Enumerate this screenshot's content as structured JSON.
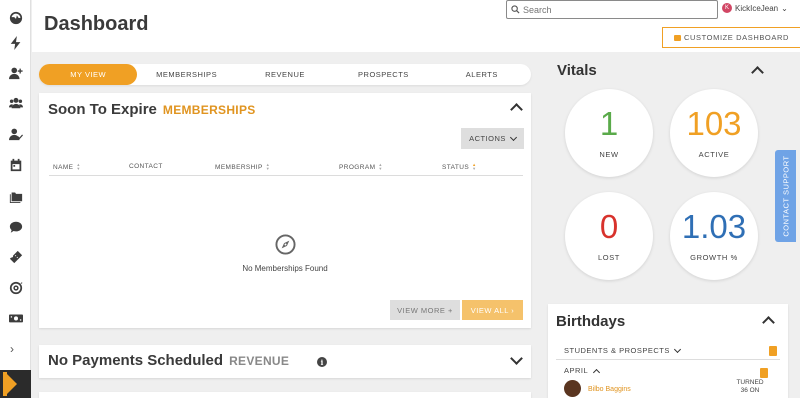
{
  "header": {
    "title": "Dashboard",
    "search_placeholder": "Search",
    "user_initial": "K",
    "user_name": "KickIceJean",
    "customize_label": "CUSTOMIZE DASHBOARD"
  },
  "sidebar": {
    "items": [
      {
        "icon": "gauge-icon"
      },
      {
        "icon": "bolt-icon"
      },
      {
        "icon": "add-user-icon"
      },
      {
        "icon": "users-icon"
      },
      {
        "icon": "user-check-icon"
      },
      {
        "icon": "calendar-icon"
      },
      {
        "icon": "folders-icon"
      },
      {
        "icon": "chat-icon"
      },
      {
        "icon": "ticket-icon"
      },
      {
        "icon": "target-icon"
      },
      {
        "icon": "money-icon"
      }
    ],
    "expand_glyph": "›"
  },
  "tabs": [
    {
      "label": "MY VIEW",
      "active": true
    },
    {
      "label": "MEMBERSHIPS",
      "active": false
    },
    {
      "label": "REVENUE",
      "active": false
    },
    {
      "label": "PROSPECTS",
      "active": false
    },
    {
      "label": "ALERTS",
      "active": false
    }
  ],
  "expire_panel": {
    "title": "Soon To Expire",
    "subtitle": "MEMBERSHIPS",
    "actions_label": "ACTIONS",
    "columns": [
      "NAME",
      "CONTACT",
      "MEMBERSHIP",
      "PROGRAM",
      "STATUS"
    ],
    "empty_text": "No Memberships Found",
    "view_more_label": "VIEW MORE +",
    "view_all_label": "VIEW ALL ›"
  },
  "payments_panel": {
    "title": "No Payments Scheduled",
    "subtitle": "REVENUE",
    "info_glyph": "i"
  },
  "vitals": {
    "title": "Vitals",
    "items": [
      {
        "value": "1",
        "label": "NEW",
        "color": "#5aaa4a"
      },
      {
        "value": "103",
        "label": "ACTIVE",
        "color": "#f0a024"
      },
      {
        "value": "0",
        "label": "LOST",
        "color": "#d8322c"
      },
      {
        "value": "1.03",
        "label": "GROWTH %",
        "color": "#2f6fb5"
      }
    ]
  },
  "contact_support_label": "CONTACT SUPPORT",
  "birthdays": {
    "title": "Birthdays",
    "filter_label": "STUDENTS & PROSPECTS",
    "month_label": "APRIL",
    "entries": [
      {
        "name": "Bilbo Baggins",
        "turned_text": "TURNED 36 ON"
      }
    ]
  },
  "colors": {
    "accent": "#f0a024",
    "accent_light": "#f5c26b",
    "support_blue": "#6fa3e6"
  }
}
